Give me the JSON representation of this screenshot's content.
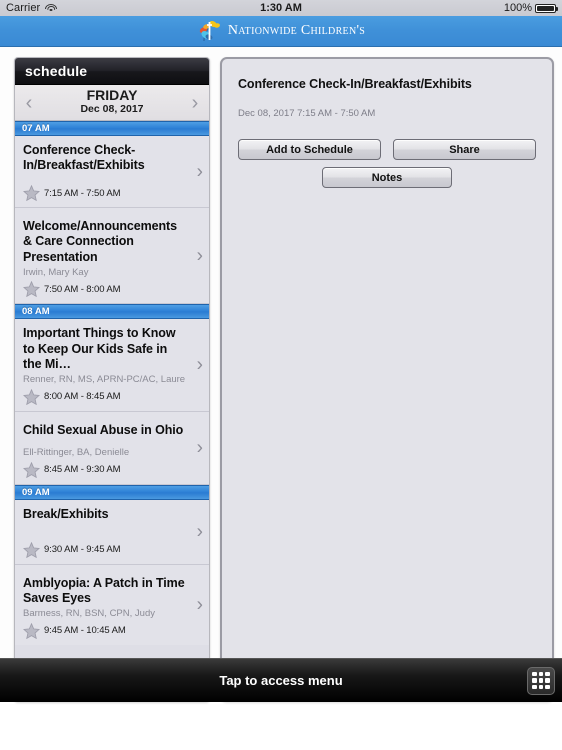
{
  "status_bar": {
    "carrier": "Carrier",
    "wifi_icon": "wifi-icon",
    "time": "1:30 AM",
    "battery_percent": "100%",
    "battery_icon": "battery-full-icon"
  },
  "app_header": {
    "logo_icon": "nationwide-childrens-logo-icon",
    "logo_text": "Nationwide Children's"
  },
  "sidebar": {
    "header_title": "schedule",
    "prev_day_icon": "chevron-left-icon",
    "next_day_icon": "chevron-right-icon",
    "day_name": "FRIDAY",
    "day_date": "Dec 08, 2017",
    "groups": [
      {
        "hour": "07 AM",
        "sessions": [
          {
            "title": "Conference Check-In/Breakfast/Exhibits",
            "speaker": "",
            "time": "7:15 AM - 7:50 AM",
            "favorite_icon": "star-outline-icon",
            "disclosure_icon": "chevron-right-icon"
          },
          {
            "title": "Welcome/Announcements & Care Connection Presentation",
            "speaker": "Irwin, Mary Kay",
            "time": "7:50 AM - 8:00 AM",
            "favorite_icon": "star-outline-icon",
            "disclosure_icon": "chevron-right-icon"
          }
        ]
      },
      {
        "hour": "08 AM",
        "sessions": [
          {
            "title": "Important Things to Know to Keep Our Kids Safe in the Mi…",
            "speaker": "Renner, RN, MS, APRN-PC/AC, Lauren, W…",
            "time": "8:00 AM - 8:45 AM",
            "favorite_icon": "star-outline-icon",
            "disclosure_icon": "chevron-right-icon"
          },
          {
            "title": "Child Sexual Abuse in Ohio",
            "speaker": "Ell-Rittinger, BA, Denielle",
            "time": "8:45 AM - 9:30 AM",
            "favorite_icon": "star-outline-icon",
            "disclosure_icon": "chevron-right-icon"
          }
        ]
      },
      {
        "hour": "09 AM",
        "sessions": [
          {
            "title": "Break/Exhibits",
            "speaker": "",
            "time": "9:30 AM - 9:45 AM",
            "favorite_icon": "star-outline-icon",
            "disclosure_icon": "chevron-right-icon"
          },
          {
            "title": "Amblyopia: A Patch in Time Saves Eyes",
            "speaker": "Barmess, RN, BSN, CPN, Judy",
            "time": "9:45 AM - 10:45 AM",
            "favorite_icon": "star-outline-icon",
            "disclosure_icon": "chevron-right-icon"
          }
        ]
      }
    ]
  },
  "detail": {
    "title": "Conference Check-In/Breakfast/Exhibits",
    "datetime": "Dec 08, 2017 7:15 AM - 7:50 AM",
    "add_button": "Add to Schedule",
    "share_button": "Share",
    "notes_button": "Notes"
  },
  "bottom_bar": {
    "label": "Tap to access menu",
    "grid_icon": "grid-menu-icon"
  },
  "colors": {
    "accent_blue": "#3f90d8",
    "hour_blue": "#2d80d6",
    "panel_gray": "#e3e3e9",
    "dark_bar": "#18181c"
  }
}
